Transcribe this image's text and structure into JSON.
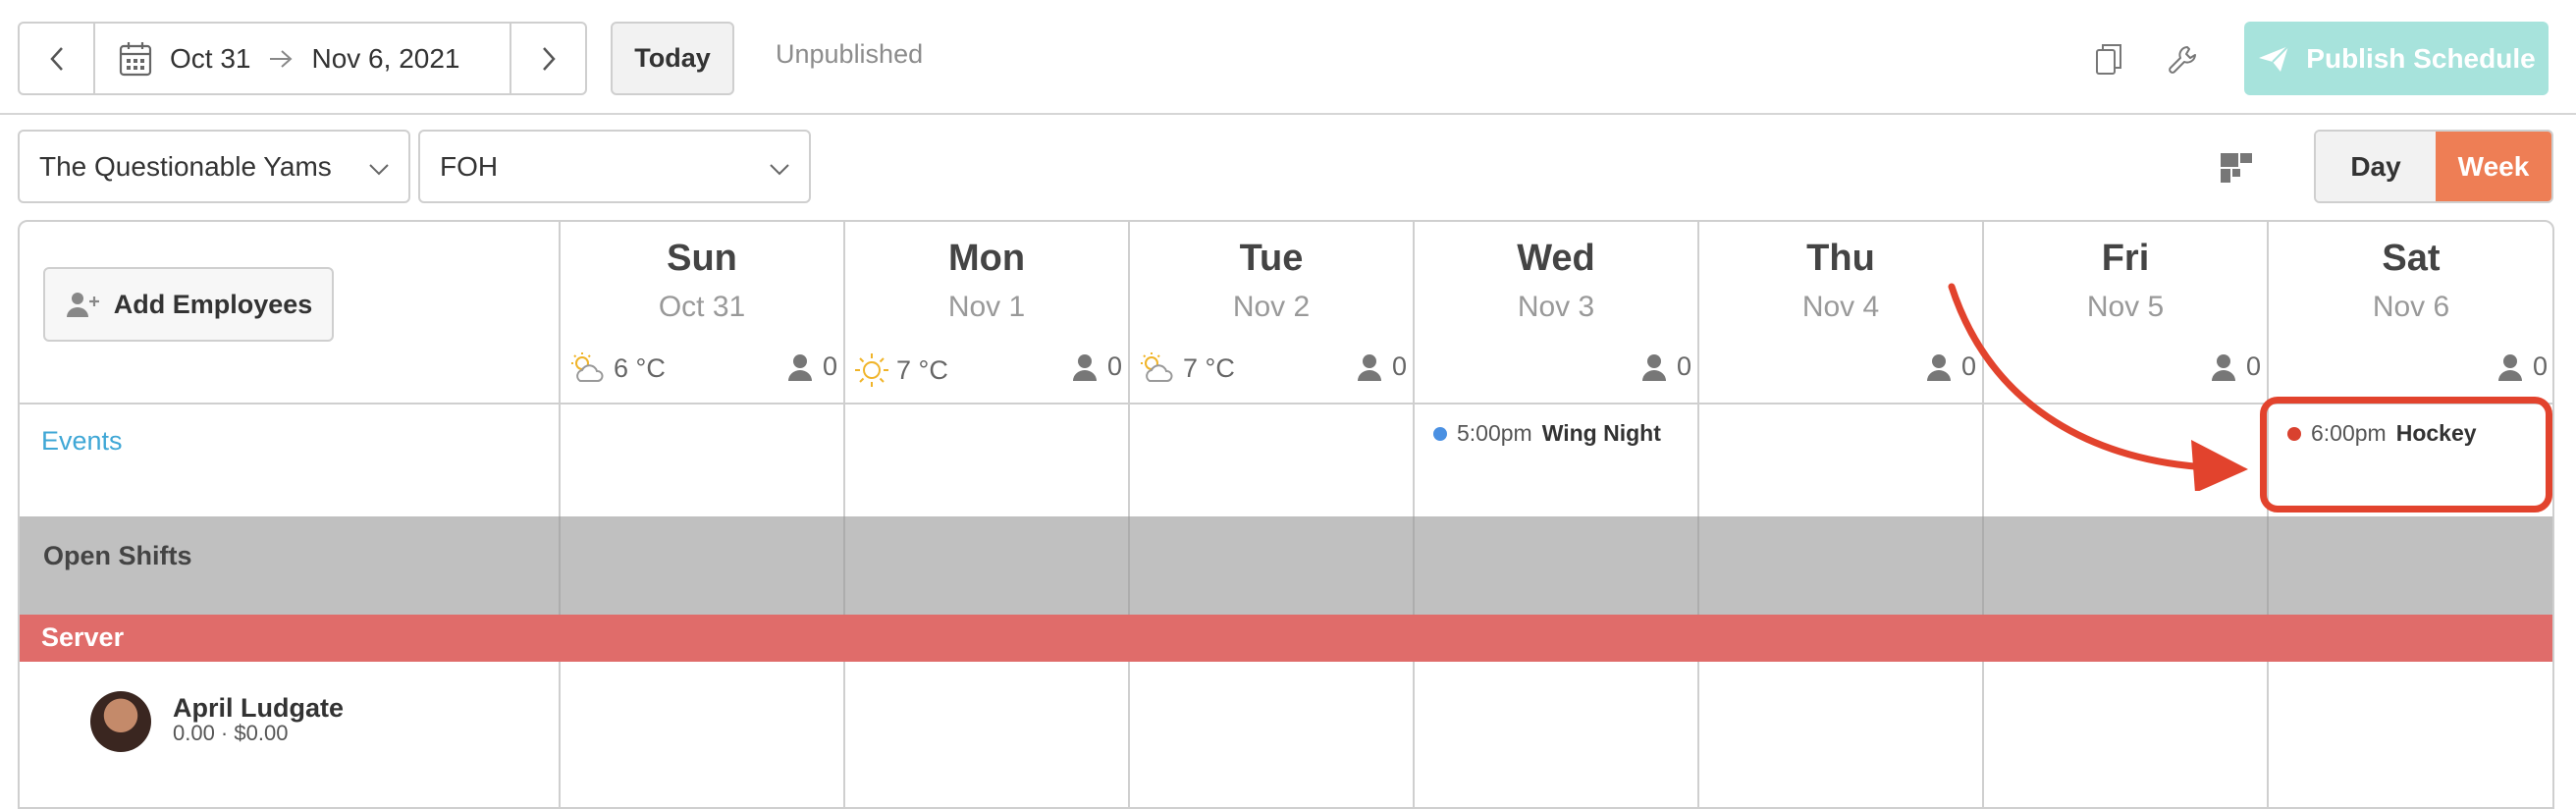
{
  "toolbar": {
    "date_range": {
      "start": "Oct 31",
      "end": "Nov 6, 2021"
    },
    "today_label": "Today",
    "status": "Unpublished",
    "publish_label": "Publish Schedule"
  },
  "filters": {
    "location": "The Questionable Yams",
    "department": "FOH",
    "view": {
      "day_label": "Day",
      "week_label": "Week",
      "active": "Week"
    }
  },
  "schedule": {
    "add_employees_label": "Add Employees",
    "days": [
      {
        "name": "Sun",
        "date": "Oct 31",
        "temp": "6 °C",
        "weather_icon": "partly-cloudy-icon",
        "staff_count": "0"
      },
      {
        "name": "Mon",
        "date": "Nov 1",
        "temp": "7 °C",
        "weather_icon": "sunny-icon",
        "staff_count": "0"
      },
      {
        "name": "Tue",
        "date": "Nov 2",
        "temp": "7 °C",
        "weather_icon": "partly-cloudy-icon",
        "staff_count": "0"
      },
      {
        "name": "Wed",
        "date": "Nov 3",
        "temp": "",
        "weather_icon": "",
        "staff_count": "0"
      },
      {
        "name": "Thu",
        "date": "Nov 4",
        "temp": "",
        "weather_icon": "",
        "staff_count": "0"
      },
      {
        "name": "Fri",
        "date": "Nov 5",
        "temp": "",
        "weather_icon": "",
        "staff_count": "0"
      },
      {
        "name": "Sat",
        "date": "Nov 6",
        "temp": "",
        "weather_icon": "",
        "staff_count": "0"
      }
    ],
    "events_label": "Events",
    "events": [
      {
        "day": "Wed",
        "time": "5:00pm",
        "title": "Wing Night",
        "color": "#4a90e2"
      },
      {
        "day": "Sat",
        "time": "6:00pm",
        "title": "Hockey",
        "color": "#d9412f"
      }
    ],
    "open_shifts_label": "Open Shifts",
    "role_label": "Server",
    "role_color": "#e06c6a",
    "employees": [
      {
        "name": "April Ludgate",
        "meta": "0.00 · $0.00"
      }
    ]
  },
  "colors": {
    "accent": "#ee7e55",
    "publish_disabled": "#a7e3dc",
    "events_link": "#3fa7d6",
    "annotation": "#e2432d"
  }
}
